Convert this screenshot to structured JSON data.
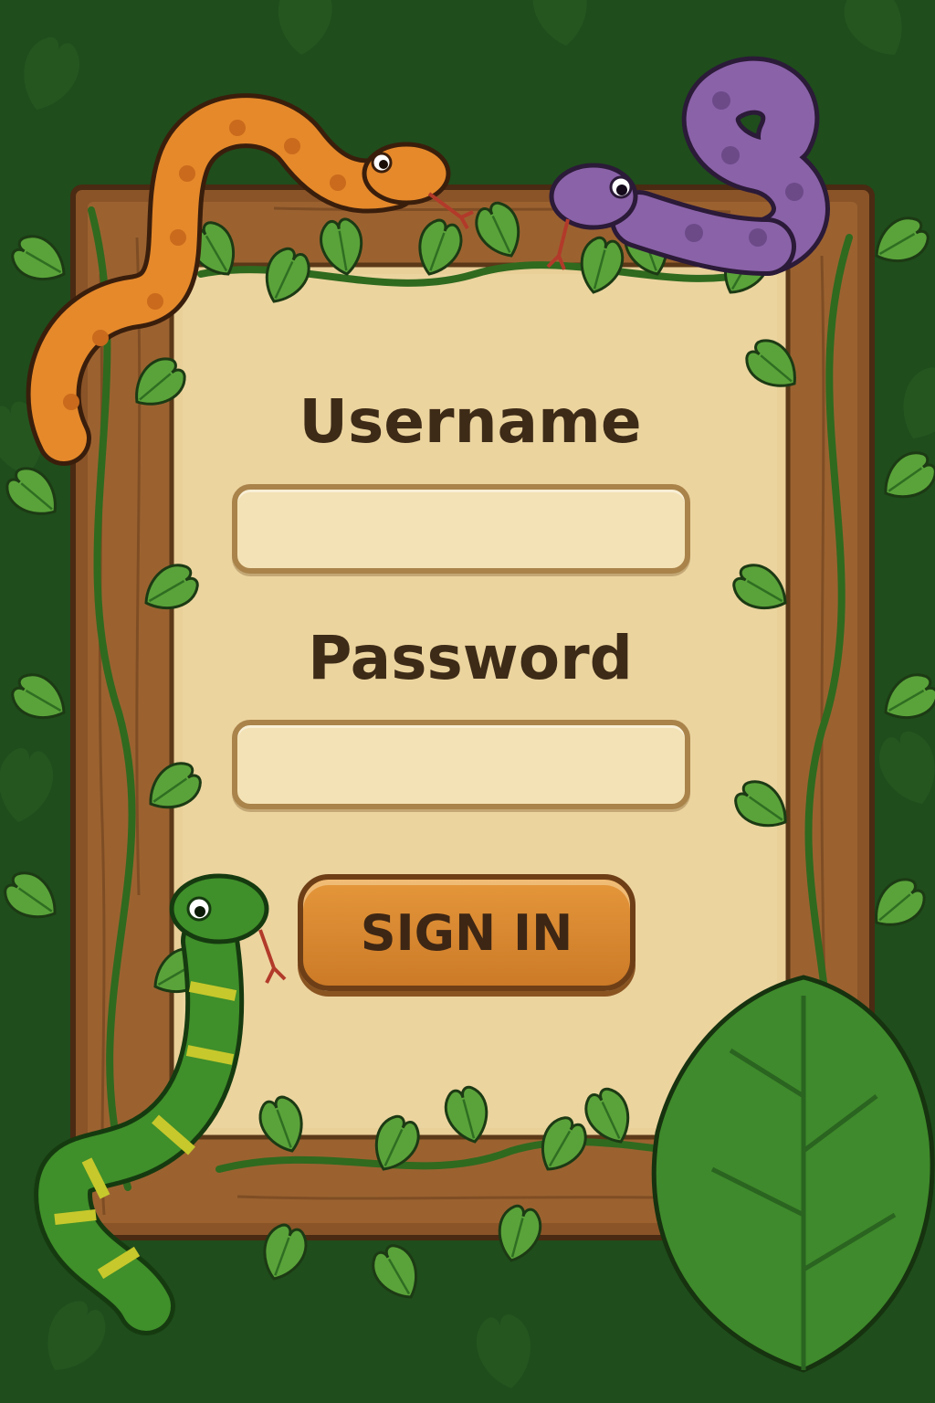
{
  "login_form": {
    "username_label": "Username",
    "username_value": "",
    "password_label": "Password",
    "password_value": "",
    "signin_label": "SIGN IN"
  },
  "decorations": {
    "snakes": [
      "orange-snake",
      "purple-snake",
      "green-snake"
    ],
    "frame": "wooden-frame",
    "foliage": "jungle-vines"
  },
  "colors": {
    "background": "#1f4d1c",
    "panel": "#e9cf98",
    "frame_wood": "#8a5428",
    "button": "#d8882f",
    "label_text": "#3d2b17",
    "input_fill": "#f3e2b5"
  }
}
